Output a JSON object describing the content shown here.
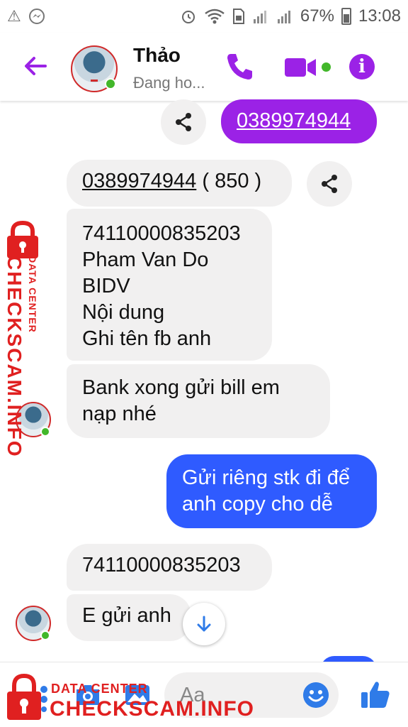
{
  "status_bar": {
    "battery_percent": "67%",
    "time": "13:08",
    "left_icons": [
      "warning-icon",
      "messenger-icon"
    ],
    "right_icons": [
      "alarm-icon",
      "wifi-icon",
      "sim-icon",
      "signal-icon",
      "signal-icon",
      "battery-icon"
    ]
  },
  "header": {
    "contact_name": "Thảo",
    "contact_status": "Đang ho...",
    "accent_color": "#9b22e6",
    "online_color": "#42b72a",
    "icons": [
      "back-arrow-icon",
      "phone-icon",
      "video-icon",
      "info-icon"
    ]
  },
  "messages": [
    {
      "id": "m1",
      "side": "out",
      "color": "#9b22e6",
      "text": "0389974944",
      "underlined": true,
      "share_button": true
    },
    {
      "id": "m2",
      "side": "in",
      "text": "0389974944",
      "suffix": " ( 850 )",
      "underlined": true,
      "share_button": true
    },
    {
      "id": "m3",
      "side": "in",
      "text": "74110000835203\nPham Van Do\nBIDV\nNội dung\nGhi tên fb anh"
    },
    {
      "id": "m4",
      "side": "in",
      "text": "Bank xong gửi bill em\nnạp nhé",
      "avatar": true
    },
    {
      "id": "m5",
      "side": "out",
      "color": "#2f5bff",
      "text": "Gửi riêng stk đi để\nanh copy cho dễ"
    },
    {
      "id": "m6",
      "side": "in",
      "text": "74110000835203"
    },
    {
      "id": "m7",
      "side": "in",
      "text": "E gửi anh",
      "avatar": true
    }
  ],
  "composer": {
    "placeholder": "Aa",
    "icons": [
      "menu-dots-icon",
      "camera-icon",
      "gallery-icon",
      "mic-icon",
      "emoji-icon",
      "like-thumb-icon"
    ]
  },
  "scroll_down": {
    "icon": "arrow-down-icon"
  },
  "watermark": {
    "main": "CHECKSCAM.INFO",
    "sub": "DATA CENTER",
    "color": "#e02020"
  }
}
